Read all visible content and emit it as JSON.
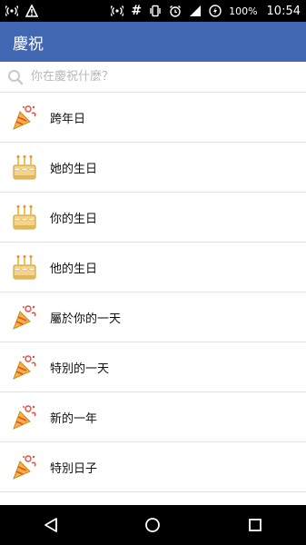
{
  "status_bar": {
    "time": "10:54",
    "battery_percent": "100%",
    "left_icons": [
      "wifi-hotspot-icon",
      "warning-triangle-icon"
    ],
    "right_icons": [
      "wifi-hotspot-icon",
      "hash-icon",
      "vibrate-icon",
      "alarm-icon",
      "lte-signal-icon",
      "battery-saver-icon"
    ]
  },
  "app_bar": {
    "title": "慶祝"
  },
  "search": {
    "placeholder": "你在慶祝什麼？",
    "value": ""
  },
  "items": [
    {
      "label": "跨年日",
      "icon": "party-popper-icon"
    },
    {
      "label": "她的生日",
      "icon": "birthday-cake-icon"
    },
    {
      "label": "你的生日",
      "icon": "birthday-cake-icon"
    },
    {
      "label": "他的生日",
      "icon": "birthday-cake-icon"
    },
    {
      "label": "屬於你的一天",
      "icon": "party-popper-icon"
    },
    {
      "label": "特別的一天",
      "icon": "party-popper-icon"
    },
    {
      "label": "新的一年",
      "icon": "party-popper-icon"
    },
    {
      "label": "特別日子",
      "icon": "party-popper-icon"
    }
  ],
  "colors": {
    "app_bar": "#4267b2",
    "status_bar": "#000000",
    "nav_bar": "#000000"
  }
}
